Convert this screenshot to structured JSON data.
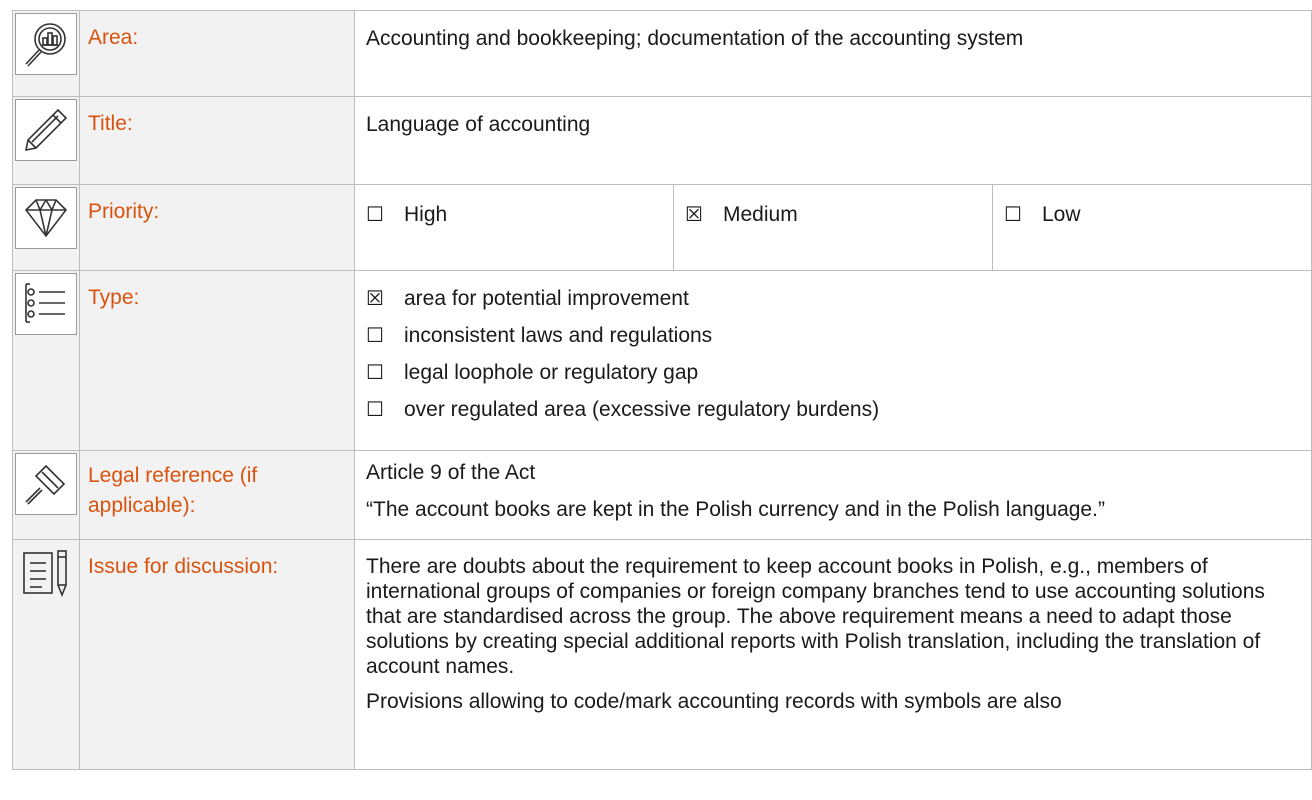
{
  "rows": {
    "area": {
      "label": "Area:",
      "value": "Accounting and bookkeeping; documentation of the accounting system"
    },
    "title": {
      "label": "Title:",
      "value": "Language of accounting"
    },
    "priority": {
      "label": "Priority:",
      "options": [
        {
          "mark": "☐",
          "label": "High",
          "checked": false
        },
        {
          "mark": "☒",
          "label": "Medium",
          "checked": true
        },
        {
          "mark": "☐",
          "label": "Low",
          "checked": false
        }
      ]
    },
    "type": {
      "label": "Type:",
      "options": [
        {
          "mark": "☒",
          "label": "area for potential improvement",
          "checked": true
        },
        {
          "mark": "☐",
          "label": "inconsistent laws and regulations",
          "checked": false
        },
        {
          "mark": "☐",
          "label": "legal loophole or regulatory gap",
          "checked": false
        },
        {
          "mark": "☐",
          "label": "over regulated area (excessive regulatory burdens)",
          "checked": false
        }
      ]
    },
    "legal": {
      "label": "Legal reference (if applicable):",
      "line1": "Article 9 of the Act",
      "line2": "“The account books are kept in the Polish currency and in the Polish language.”"
    },
    "issue": {
      "label": "Issue for discussion:",
      "para1": "There are doubts about the requirement to keep account books in Polish, e.g., members of international groups of companies or foreign company branches tend to use accounting solutions that are standardised across the group. The above requirement means a need to adapt those solutions by creating special additional reports with Polish translation, including the translation of account names.",
      "para2": "Provisions allowing to code/mark accounting records with symbols are also"
    }
  },
  "icons": [
    "magnifier-chart-icon",
    "pencil-icon",
    "diamond-icon",
    "list-icon",
    "gavel-icon",
    "document-pen-icon"
  ],
  "colors": {
    "label": "#d9530f",
    "label_bg": "#f2f2f2",
    "border": "#bdbdbd"
  }
}
